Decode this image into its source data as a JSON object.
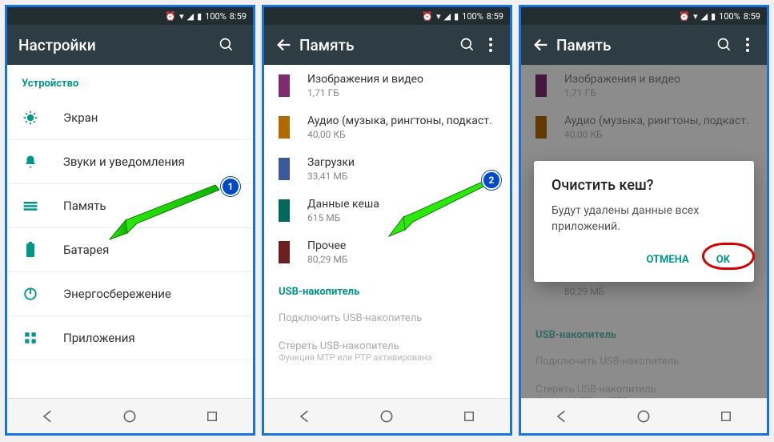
{
  "statusbar": {
    "battery": "100%",
    "time": "8:59"
  },
  "screen1": {
    "title": "Настройки",
    "sectionDevice": "Устройство",
    "items": [
      {
        "label": "Экран"
      },
      {
        "label": "Звуки и уведомления"
      },
      {
        "label": "Память"
      },
      {
        "label": "Батарея"
      },
      {
        "label": "Энергосбережение"
      },
      {
        "label": "Приложения"
      }
    ],
    "badge": "1"
  },
  "screen2": {
    "title": "Память",
    "badge": "2",
    "items": [
      {
        "label": "Изображения и видео",
        "sub": "1,71 ГБ",
        "color": "#7d2d6e"
      },
      {
        "label": "Аудио (музыка, рингтоны, подкаст.",
        "sub": "40,00 КБ",
        "color": "#b06a00"
      },
      {
        "label": "Загрузки",
        "sub": "33,41 МБ",
        "color": "#3b5998"
      },
      {
        "label": "Данные кеша",
        "sub": "615 МБ",
        "color": "#00695c"
      },
      {
        "label": "Прочее",
        "sub": "80,29 МБ",
        "color": "#6b2020"
      }
    ],
    "usbSection": "USB-накопитель",
    "usbItems": [
      {
        "label": "Подключить USB-накопитель",
        "sub": ""
      },
      {
        "label": "Стереть USB-накопитель",
        "sub": "Функция МТР или РТР активирована"
      }
    ]
  },
  "dialog": {
    "title": "Очистить кеш?",
    "message": "Будут удалены данные всех приложений.",
    "cancel": "ОТМЕНА",
    "ok": "OK"
  }
}
